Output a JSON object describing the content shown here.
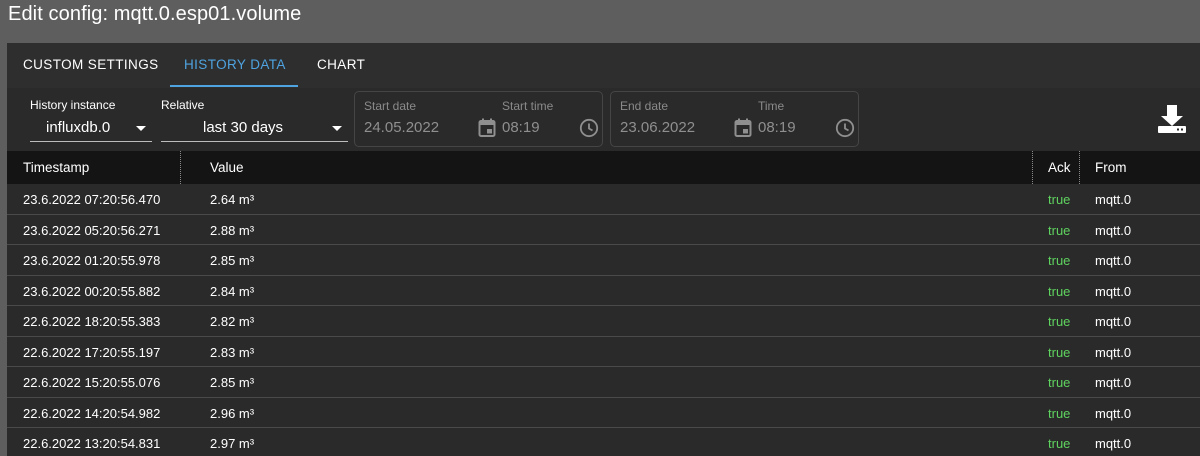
{
  "window": {
    "title": "Edit config: mqtt.0.esp01.volume"
  },
  "tabs": [
    {
      "label": "CUSTOM SETTINGS",
      "active": false
    },
    {
      "label": "HISTORY DATA",
      "active": true
    },
    {
      "label": "CHART",
      "active": false
    }
  ],
  "filters": {
    "history_instance": {
      "label": "History instance",
      "value": "influxdb.0"
    },
    "relative": {
      "label": "Relative",
      "value": "last 30 days"
    },
    "start_date": {
      "label": "Start date",
      "value": "24.05.2022"
    },
    "start_time": {
      "label": "Start time",
      "value": "08:19"
    },
    "end_date": {
      "label": "End date",
      "value": "23.06.2022"
    },
    "end_time": {
      "label": "Time",
      "value": "08:19"
    }
  },
  "table": {
    "columns": [
      "Timestamp",
      "Value",
      "Ack",
      "From"
    ],
    "rows": [
      {
        "timestamp": "23.6.2022 07:20:56.470",
        "value": "2.64 m³",
        "ack": "true",
        "from": "mqtt.0"
      },
      {
        "timestamp": "23.6.2022 05:20:56.271",
        "value": "2.88 m³",
        "ack": "true",
        "from": "mqtt.0"
      },
      {
        "timestamp": "23.6.2022 01:20:55.978",
        "value": "2.85 m³",
        "ack": "true",
        "from": "mqtt.0"
      },
      {
        "timestamp": "23.6.2022 00:20:55.882",
        "value": "2.84 m³",
        "ack": "true",
        "from": "mqtt.0"
      },
      {
        "timestamp": "22.6.2022 18:20:55.383",
        "value": "2.82 m³",
        "ack": "true",
        "from": "mqtt.0"
      },
      {
        "timestamp": "22.6.2022 17:20:55.197",
        "value": "2.83 m³",
        "ack": "true",
        "from": "mqtt.0"
      },
      {
        "timestamp": "22.6.2022 15:20:55.076",
        "value": "2.85 m³",
        "ack": "true",
        "from": "mqtt.0"
      },
      {
        "timestamp": "22.6.2022 14:20:54.982",
        "value": "2.96 m³",
        "ack": "true",
        "from": "mqtt.0"
      },
      {
        "timestamp": "22.6.2022 13:20:54.831",
        "value": "2.97 m³",
        "ack": "true",
        "from": "mqtt.0"
      }
    ]
  },
  "colors": {
    "accent": "#4ea3e0",
    "ack_true": "#5fd35f",
    "header_bg": "#141414",
    "panel_bg": "#2a2a2a"
  },
  "icons": {
    "start_date": "calendar-icon",
    "start_time": "clock-icon",
    "end_date": "calendar-icon",
    "end_time": "clock-icon",
    "download": "download-icon"
  }
}
